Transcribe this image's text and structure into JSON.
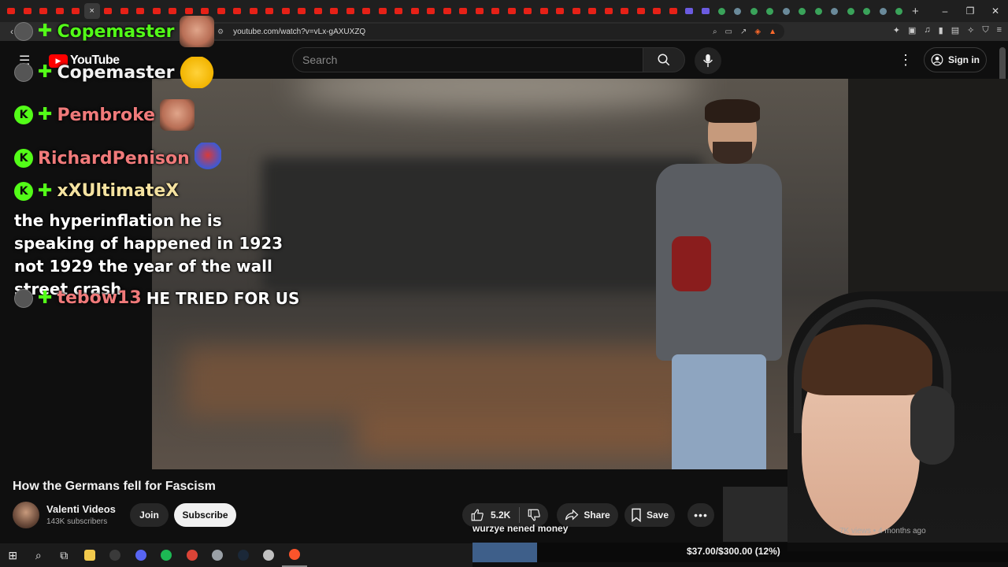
{
  "browser": {
    "url": "youtube.com/watch?v=vLx-gAXUXZQ",
    "tab_count": 56,
    "active_tab_close": "×",
    "new_tab": "+",
    "window_controls": [
      "–",
      "❐",
      "✕"
    ]
  },
  "youtube": {
    "logo_text": "YouTube",
    "search_placeholder": "Search",
    "sign_in_label": "Sign in"
  },
  "chat_overlay": {
    "messages": [
      {
        "user": "Copemaster",
        "user_color": "#53fc18",
        "badges": [
          "avatar-icon",
          "gem-icon"
        ],
        "emote": "face-emote",
        "text": ""
      },
      {
        "user": "Copemaster",
        "user_color": "#f1f1f1",
        "badges": [
          "avatar-icon",
          "gem-icon"
        ],
        "emote": "relieved-face-emote",
        "text": ""
      },
      {
        "user": "Pembroke",
        "user_color": "#f07a7a",
        "badges": [
          "kick-icon",
          "gem-icon"
        ],
        "emote": "face-emote",
        "text": ""
      },
      {
        "user": "RichardPenison",
        "user_color": "#f07a7a",
        "badges": [
          "kick-icon"
        ],
        "emote": "mario-emote",
        "text": ""
      },
      {
        "user": "xXUltimateX",
        "user_color": "#f4e2a0",
        "badges": [
          "kick-icon",
          "gem-icon"
        ],
        "emote": "",
        "text": "the hyperinflation he is speaking of happened in 1923 not 1929 the year of the wall street crash"
      },
      {
        "user": "tebow13",
        "user_color": "#f07a7a",
        "badges": [
          "avatar-icon",
          "gem-icon"
        ],
        "emote": "",
        "text": "HE TRIED FOR US"
      }
    ]
  },
  "video": {
    "title": "How the Germans fell for Fascism",
    "channel_name": "Valenti Videos",
    "subscribers": "143K subscribers",
    "join_label": "Join",
    "subscribe_label": "Subscribe",
    "likes": "5.2K",
    "share_label": "Share",
    "save_label": "Save",
    "more_label": "•••",
    "sidebar_meta": "7K views • 4 months ago"
  },
  "stream_overlay": {
    "subtitle": "wurzye nened money",
    "goal_text": "$37.00/$300.00 (12%)",
    "goal_fraction": 0.12,
    "goal_color": "#3e5f8a"
  },
  "taskbar": {
    "icons": [
      "windows-start-icon",
      "search-icon",
      "task-view-icon",
      "file-explorer-icon",
      "obs-icon",
      "discord-icon",
      "spotify-icon",
      "chrome-icon",
      "app-icon",
      "steam-icon",
      "app-icon-2",
      "brave-icon"
    ]
  },
  "colors": {
    "kick_green": "#53fc18",
    "youtube_red": "#ff0000",
    "background": "#0f0f0f"
  }
}
